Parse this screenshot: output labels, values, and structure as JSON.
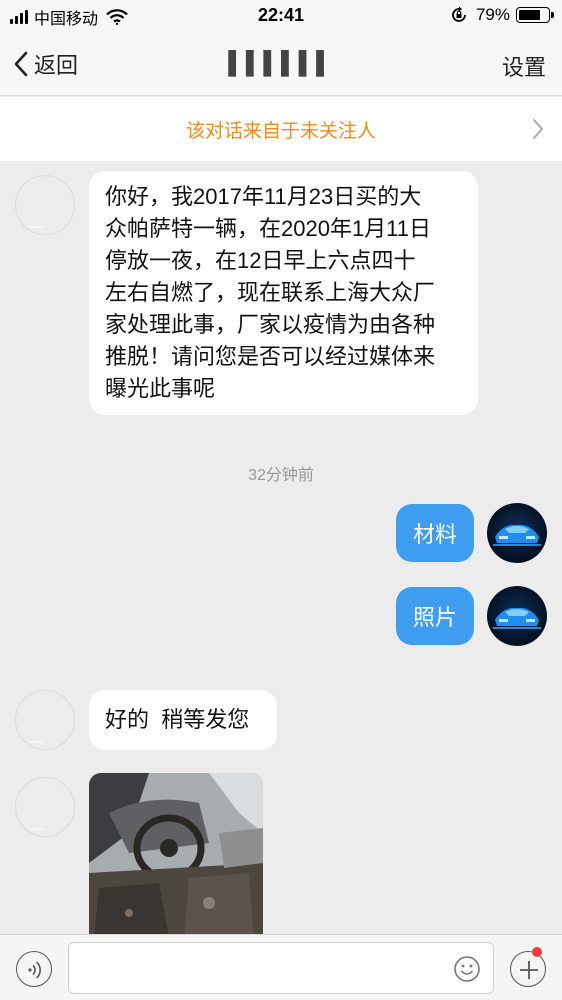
{
  "status_bar": {
    "carrier": "中国移动",
    "time": "22:41",
    "battery_percent": "79%",
    "battery_level": 0.79
  },
  "nav": {
    "back_label": "返回",
    "title": "▌▌▌▌▌▌",
    "settings_label": "设置"
  },
  "notice": {
    "text": "该对话来自于未关注人"
  },
  "messages": [
    {
      "side": "left",
      "lines": [
        "你好，我2017年11月23日买的大",
        "众帕萨特一辆，在2020年1月11日",
        "停放一夜，在12日早上六点四十",
        "左右自燃了，现在联系上海大众厂",
        "家处理此事，厂家以疫情为由各种",
        "推脱！请问您是否可以经过媒体来",
        "曝光此事呢"
      ]
    },
    {
      "side": "right",
      "text": "材料"
    },
    {
      "side": "right",
      "text": "照片"
    },
    {
      "side": "left",
      "text": "好的  稍等发您"
    },
    {
      "side": "left",
      "type": "image",
      "description": "burned car interior photo"
    }
  ],
  "timestamp": "32分钟前",
  "colors": {
    "accent_blue": "#3f9df0",
    "notice_orange": "#f08b1d",
    "badge_red": "#f43b3b"
  }
}
